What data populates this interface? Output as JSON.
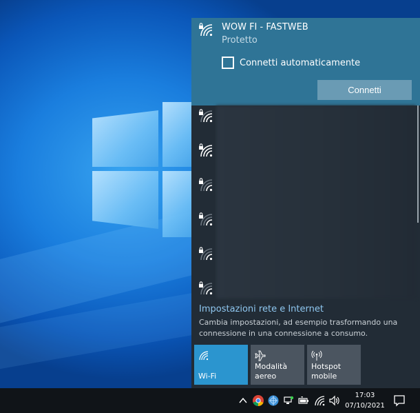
{
  "selected_network": {
    "name": "WOW FI - FASTWEB",
    "status": "Protetto",
    "auto_connect_label": "Connetti automaticamente",
    "auto_connect_checked": false,
    "connect_label": "Connetti",
    "icon": "wifi-secured-icon"
  },
  "other_networks": [
    {
      "icon": "wifi-secured-icon"
    },
    {
      "icon": "wifi-secured-icon"
    },
    {
      "icon": "wifi-secured-icon"
    },
    {
      "icon": "wifi-secured-icon"
    },
    {
      "icon": "wifi-secured-icon"
    },
    {
      "icon": "wifi-secured-icon"
    }
  ],
  "settings": {
    "title": "Impostazioni rete e Internet",
    "description": "Cambia impostazioni, ad esempio trasformando una connessione in una connessione a consumo."
  },
  "quick_actions": [
    {
      "label": "Wi-Fi",
      "icon": "wifi-icon",
      "active": true
    },
    {
      "label": "Modalità aereo",
      "icon": "airplane-icon",
      "active": false
    },
    {
      "label": "Hotspot mobile",
      "icon": "hotspot-icon",
      "active": false
    }
  ],
  "taskbar": {
    "time": "17:03",
    "date": "07/10/2021",
    "tray_icons": [
      "chevron-up-icon",
      "chrome-icon",
      "browser-icon",
      "network-device-icon",
      "battery-icon",
      "wifi-icon",
      "volume-icon"
    ],
    "notification_icon": "action-center-icon"
  },
  "colors": {
    "selected_bg": "#2f7496",
    "flyout_bg": "#222c36",
    "accent_link": "#8fc7f0",
    "active_tile": "#2b95cf",
    "tile": "#4b5560"
  }
}
